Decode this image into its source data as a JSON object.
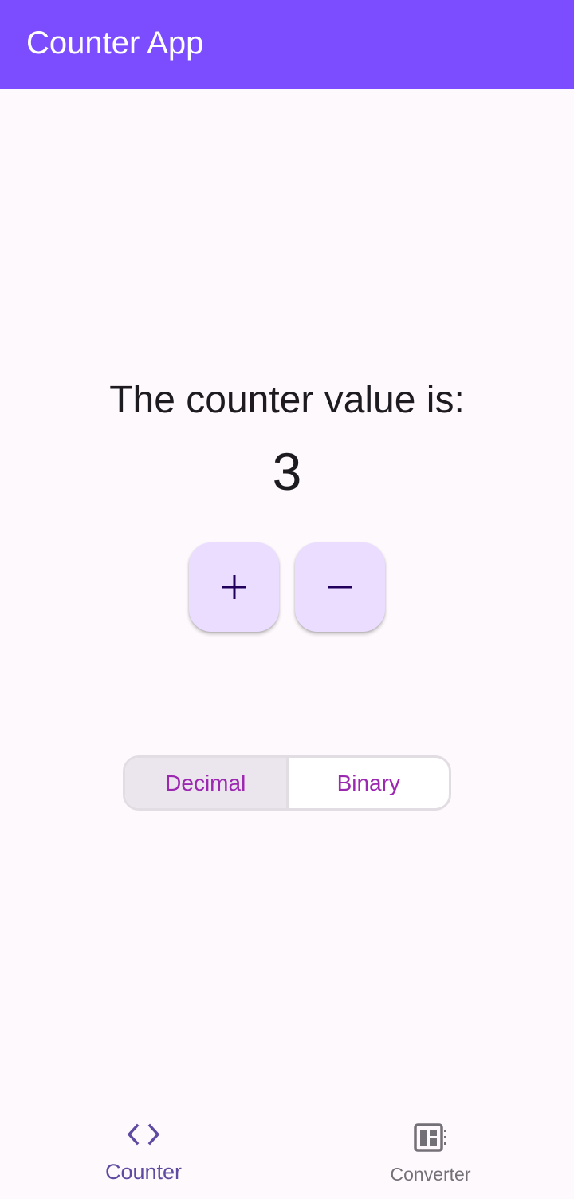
{
  "app_bar": {
    "title": "Counter App",
    "background_color": "#7c4dff"
  },
  "counter": {
    "label": "The counter value is:",
    "value": "3"
  },
  "actions": {
    "increment_icon": "plus-icon",
    "decrement_icon": "minus-icon"
  },
  "mode_toggle": {
    "options": [
      "Decimal",
      "Binary"
    ],
    "selected": "Decimal"
  },
  "bottom_nav": {
    "items": [
      {
        "label": "Counter",
        "icon": "code-icon",
        "selected": true
      },
      {
        "label": "Converter",
        "icon": "dashboard-icon",
        "selected": false
      }
    ]
  },
  "colors": {
    "accent": "#7c4dff",
    "fab_background": "#eaddff",
    "segment_text": "#9c27b0",
    "nav_selected": "#5e4aa0",
    "nav_unselected": "#737077"
  }
}
